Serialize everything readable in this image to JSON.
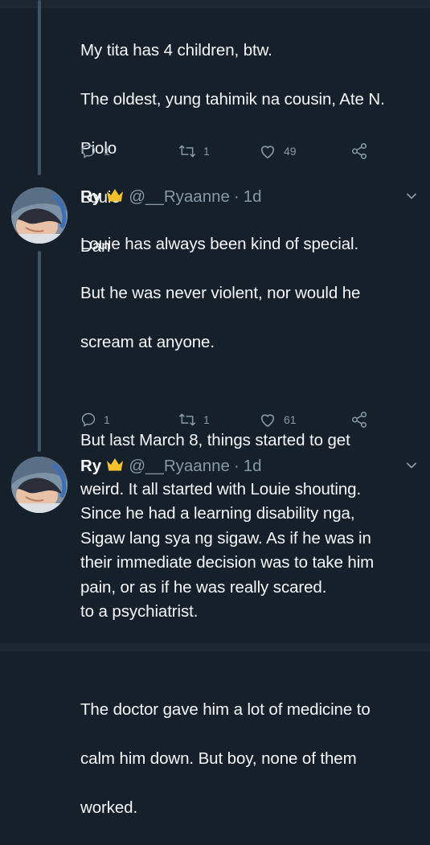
{
  "tweet1": {
    "lines": [
      "My tita has 4 children, btw.",
      "The oldest, yung tahimik na cousin, Ate N.",
      "Piolo",
      "Louie",
      "Dan"
    ],
    "replies": "1",
    "retweets": "1",
    "likes": "49"
  },
  "tweet2": {
    "name": "Ry",
    "handle": "@__Ryaanne",
    "dot": "·",
    "time": "1d",
    "lines": [
      "Louie has always been kind of special.",
      "But he was never violent, nor would he",
      "scream at anyone.",
      "",
      "But last March 8, things started to get",
      "weird. It all started with Louie shouting.",
      "Sigaw lang sya ng sigaw. As if he was in",
      "pain, or as if he was really scared."
    ],
    "replies": "1",
    "retweets": "1",
    "likes": "61"
  },
  "tweet3": {
    "name": "Ry",
    "handle": "@__Ryaanne",
    "dot": "·",
    "time": "1d",
    "lines": [
      "Since he had a learning disability nga,",
      "their immediate decision was to take him",
      "to a psychiatrist.",
      "",
      "The doctor gave him a lot of medicine to",
      "calm him down. But boy, none of them",
      "worked."
    ]
  },
  "icons": {
    "reply": "reply-icon",
    "retweet": "retweet-icon",
    "like": "heart-icon",
    "share": "share-icon",
    "crown": "crown-icon",
    "chevron": "chevron-down-icon"
  },
  "colors": {
    "background": "#15202b",
    "text": "#f5f8fa",
    "secondary": "#8899a6",
    "crown": "#f5c22b"
  }
}
